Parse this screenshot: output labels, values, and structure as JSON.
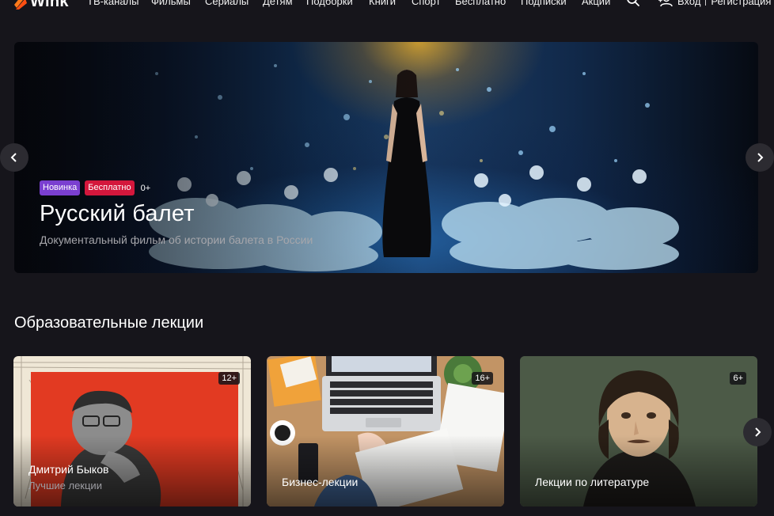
{
  "header": {
    "logo_text": "Wink",
    "nav": [
      "ТВ-каналы",
      "Фильмы",
      "Сериалы",
      "Детям",
      "Подборки",
      "Книги",
      "Спорт",
      "Бесплатно",
      "Подписки",
      "Акции"
    ],
    "login": "Вход",
    "register": "Регистрация"
  },
  "hero": {
    "badge_new": "Новинка",
    "badge_free": "Бесплатно",
    "age": "0+",
    "title": "Русский балет",
    "subtitle": "Документальный фильм об истории балета в России"
  },
  "section": {
    "title": "Образовательные лекции",
    "cards": [
      {
        "title": "Дмитрий Быков",
        "subtitle": "Лучшие лекции",
        "age": "12+"
      },
      {
        "title": "Бизнес-лекции",
        "subtitle": "",
        "age": "16+"
      },
      {
        "title": "Лекции по литературе",
        "subtitle": "",
        "age": "6+"
      }
    ]
  },
  "colors": {
    "background": "#16151b",
    "accent": "#ff4f12",
    "badge_new": "#7a3fd0",
    "badge_free": "#d4173c"
  },
  "icons": [
    "wink-logo-icon",
    "search-icon",
    "user-add-icon",
    "chevron-left-icon",
    "chevron-right-icon"
  ]
}
